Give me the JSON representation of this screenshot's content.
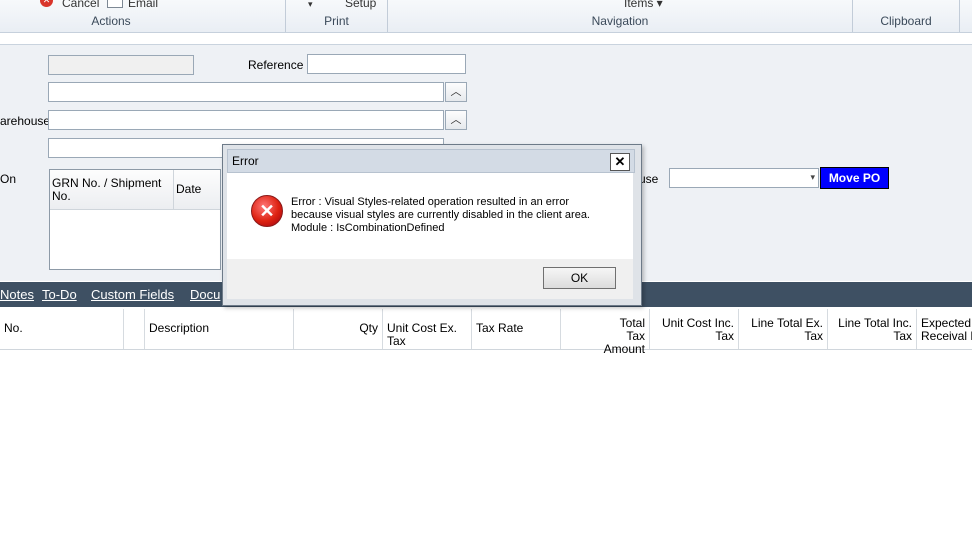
{
  "ribbon": {
    "items": {
      "cancel": "Cancel",
      "email": "Email",
      "setup": "Setup",
      "items": "Items ▾"
    },
    "groups": [
      "Actions",
      "Print",
      "Navigation",
      "Clipboard"
    ]
  },
  "form": {
    "reference_label": "Reference",
    "warehouse_label": "arehouse",
    "on_label": "On",
    "use_label": "use",
    "grid_headers": [
      "GRN No. / Shipment No.",
      "Date"
    ],
    "move_po_button": "Move PO"
  },
  "tabs": [
    "Notes",
    "To-Do",
    "Custom Fields",
    "Docu"
  ],
  "line_grid_headers": [
    "No.",
    "",
    "Description",
    "Qty",
    "Unit Cost Ex. Tax",
    "Tax Rate",
    "Total Tax Amount",
    "Unit Cost Inc. Tax",
    "Line Total Ex. Tax",
    "Line Total Inc. Tax",
    "Expected Receival D"
  ],
  "dialog": {
    "title": "Error",
    "message_line1": "Error : Visual Styles-related operation resulted in an error",
    "message_line2": "because visual styles are currently disabled in the client area.",
    "message_line3": "Module : IsCombinationDefined",
    "ok": "OK"
  },
  "colors": {
    "tabbar_bg": "#3e5063",
    "move_po_bg": "#0000ff"
  }
}
